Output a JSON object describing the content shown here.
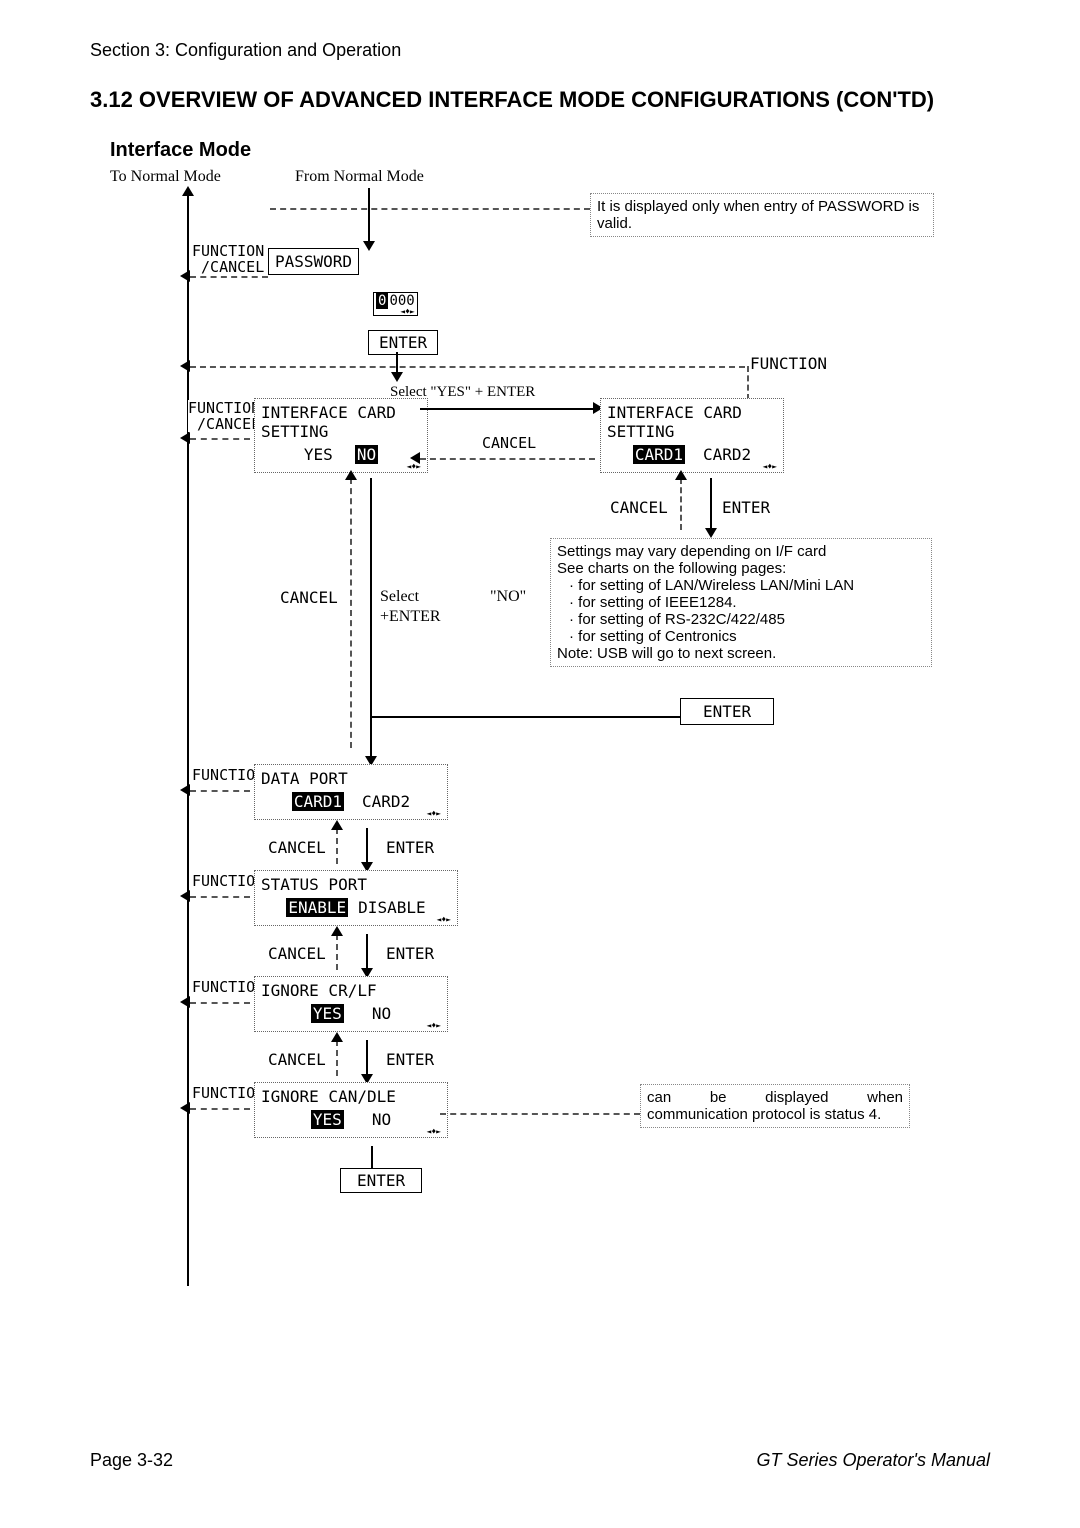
{
  "header": {
    "section_path": "Section 3: Configuration and Operation"
  },
  "title": "3.12 OVERVIEW OF ADVANCED INTERFACE MODE CONFIGURATIONS (CON'TD)",
  "subhead": "Interface Mode",
  "top_labels": {
    "to_normal": "To Normal Mode",
    "from_normal": "From Normal Mode"
  },
  "notes": {
    "password_note": "It is displayed only when entry of PASSWORD is valid.",
    "settings_note": {
      "l1": "Settings may vary depending on I/F card",
      "l2": "See charts on the following pages:",
      "b1": "· for setting of LAN/Wireless LAN/Mini LAN",
      "b2": "· for setting of IEEE1284.",
      "b3": "· for setting of RS-232C/422/485",
      "b4": "· for setting of Centronics",
      "l3": "Note: USB will go to next screen."
    },
    "can_dle_note": "can be displayed when communication protocol is status 4."
  },
  "boxes": {
    "password": "PASSWORD",
    "zerozeros": "000",
    "iface_left": {
      "l1": "INTERFACE CARD",
      "l2": "SETTING",
      "opt1": "YES",
      "opt2": "NO"
    },
    "iface_right": {
      "l1": "INTERFACE CARD",
      "l2": "SETTING",
      "opt1": "CARD1",
      "opt2": "CARD2"
    },
    "data_port": {
      "title": "DATA PORT",
      "opt1": "CARD1",
      "opt2": "CARD2"
    },
    "status_port": {
      "title": "STATUS PORT",
      "opt1": "ENABLE",
      "opt2": "DISABLE"
    },
    "ignore_crlf": {
      "title": "IGNORE CR/LF",
      "opt1": "YES",
      "opt2": "NO"
    },
    "ignore_candle": {
      "title": "IGNORE CAN/DLE",
      "opt1": "YES",
      "opt2": "NO"
    }
  },
  "labels": {
    "func_cancel": "FUNCTION\n /CANCEL",
    "function": "FUNCTION",
    "enter": "ENTER",
    "cancel": "CANCEL",
    "select_yes_enter": "Select \"YES\" + ENTER",
    "select": "Select",
    "plus_enter": "+ENTER",
    "no_quoted": "\"NO\""
  },
  "footer": {
    "page": "Page 3-32",
    "manual": "GT Series Operator's Manual"
  }
}
